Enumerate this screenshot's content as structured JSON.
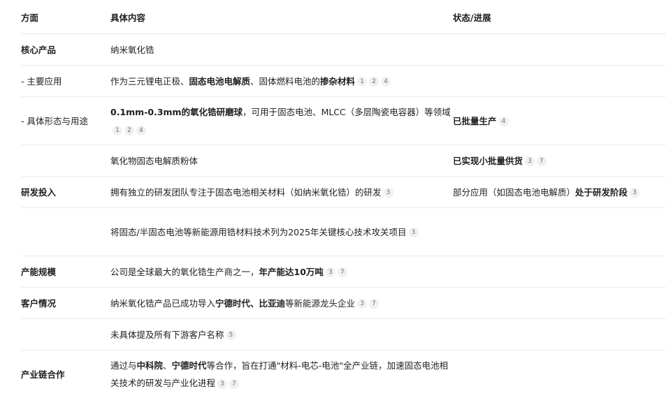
{
  "headers": {
    "aspect": "方面",
    "content": "具体内容",
    "status": "状态/进展"
  },
  "rows": [
    {
      "aspect": "核心产品",
      "content_parts": [
        "纳米氧化锆"
      ],
      "status_parts": [],
      "content_refs": [],
      "status_refs": []
    },
    {
      "aspect": "- 主要应用",
      "content_parts": [
        "作为三元锂电正极、",
        "固态电池电解质",
        "、固体燃料电池的",
        "掺杂材料"
      ],
      "content_refs": [
        "1",
        "2",
        "4"
      ],
      "status_parts": [],
      "status_refs": []
    },
    {
      "aspect": "- 具体形态与用途",
      "content_parts": [
        "0.1mm-0.3mm的氧化锆研磨球",
        "，可用于固态电池、MLCC（多层陶瓷电容器）等领域"
      ],
      "content_refs": [
        "1",
        "2",
        "4"
      ],
      "status_parts": [
        "已批量生产"
      ],
      "status_refs": [
        "4"
      ]
    },
    {
      "aspect": "",
      "content_parts": [
        "氧化物固态电解质粉体"
      ],
      "content_refs": [],
      "status_parts": [
        "已实现小批量供货"
      ],
      "status_refs": [
        "3",
        "7"
      ]
    },
    {
      "aspect": "研发投入",
      "content_parts": [
        "拥有独立的研发团队专注于固态电池相关材料（如纳米氧化锆）的研发"
      ],
      "content_refs": [
        "3"
      ],
      "status_parts": [
        "部分应用（如固态电池电解质）",
        "处于研发阶段"
      ],
      "status_refs": [
        "3"
      ]
    },
    {
      "aspect": "",
      "content_parts": [
        "将固态/半固态电池等新能源用锆材料技术列为2025年关键核心技术攻关项目"
      ],
      "content_refs": [
        "3"
      ],
      "status_parts": [],
      "status_refs": []
    },
    {
      "aspect": "产能规模",
      "content_parts": [
        "公司是全球最大的氧化锆生产商之一，",
        "年产能达10万吨"
      ],
      "content_refs": [
        "3",
        "7"
      ],
      "status_parts": [],
      "status_refs": []
    },
    {
      "aspect": "客户情况",
      "content_parts": [
        "纳米氧化锆产品已成功导入",
        "宁德时代、比亚迪",
        "等新能源龙头企业"
      ],
      "content_refs": [
        "3",
        "7"
      ],
      "status_parts": [],
      "status_refs": []
    },
    {
      "aspect": "",
      "content_parts": [
        "未具体提及所有下游客户名称"
      ],
      "content_refs": [
        "5"
      ],
      "status_parts": [],
      "status_refs": []
    },
    {
      "aspect": "产业链合作",
      "content_parts": [
        "通过与",
        "中科院",
        "、",
        "宁德时代",
        "等合作，旨在打通\"材料-电芯-电池\"全产业链，加速固态电池相关技术的研发与产业化进程"
      ],
      "content_refs": [
        "3",
        "7"
      ],
      "status_parts": [],
      "status_refs": []
    }
  ]
}
